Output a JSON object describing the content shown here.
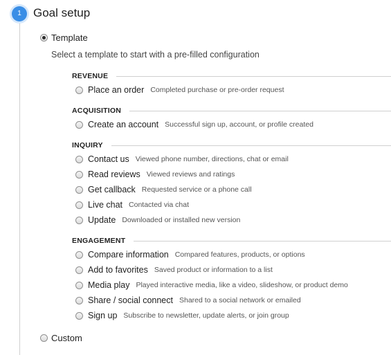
{
  "step": {
    "number": "1",
    "title": "Goal setup"
  },
  "template_option": {
    "label": "Template",
    "selected": true
  },
  "intro": "Select a template to start with a pre-filled configuration",
  "categories": [
    {
      "name": "REVENUE",
      "options": [
        {
          "name": "Place an order",
          "desc": "Completed purchase or pre-order request"
        }
      ]
    },
    {
      "name": "ACQUISITION",
      "options": [
        {
          "name": "Create an account",
          "desc": "Successful sign up, account, or profile created"
        }
      ]
    },
    {
      "name": "INQUIRY",
      "options": [
        {
          "name": "Contact us",
          "desc": "Viewed phone number, directions, chat or email"
        },
        {
          "name": "Read reviews",
          "desc": "Viewed reviews and ratings"
        },
        {
          "name": "Get callback",
          "desc": "Requested service or a phone call"
        },
        {
          "name": "Live chat",
          "desc": "Contacted via chat"
        },
        {
          "name": "Update",
          "desc": "Downloaded or installed new version"
        }
      ]
    },
    {
      "name": "ENGAGEMENT",
      "options": [
        {
          "name": "Compare information",
          "desc": "Compared features, products, or options"
        },
        {
          "name": "Add to favorites",
          "desc": "Saved product or information to a list"
        },
        {
          "name": "Media play",
          "desc": "Played interactive media, like a video, slideshow, or product demo"
        },
        {
          "name": "Share / social connect",
          "desc": "Shared to a social network or emailed"
        },
        {
          "name": "Sign up",
          "desc": "Subscribe to newsletter, update alerts, or join group"
        }
      ]
    }
  ],
  "custom_option": {
    "label": "Custom",
    "selected": false
  },
  "colors": {
    "step_circle": "#3a8ee6",
    "rail": "#cfcfcf"
  }
}
